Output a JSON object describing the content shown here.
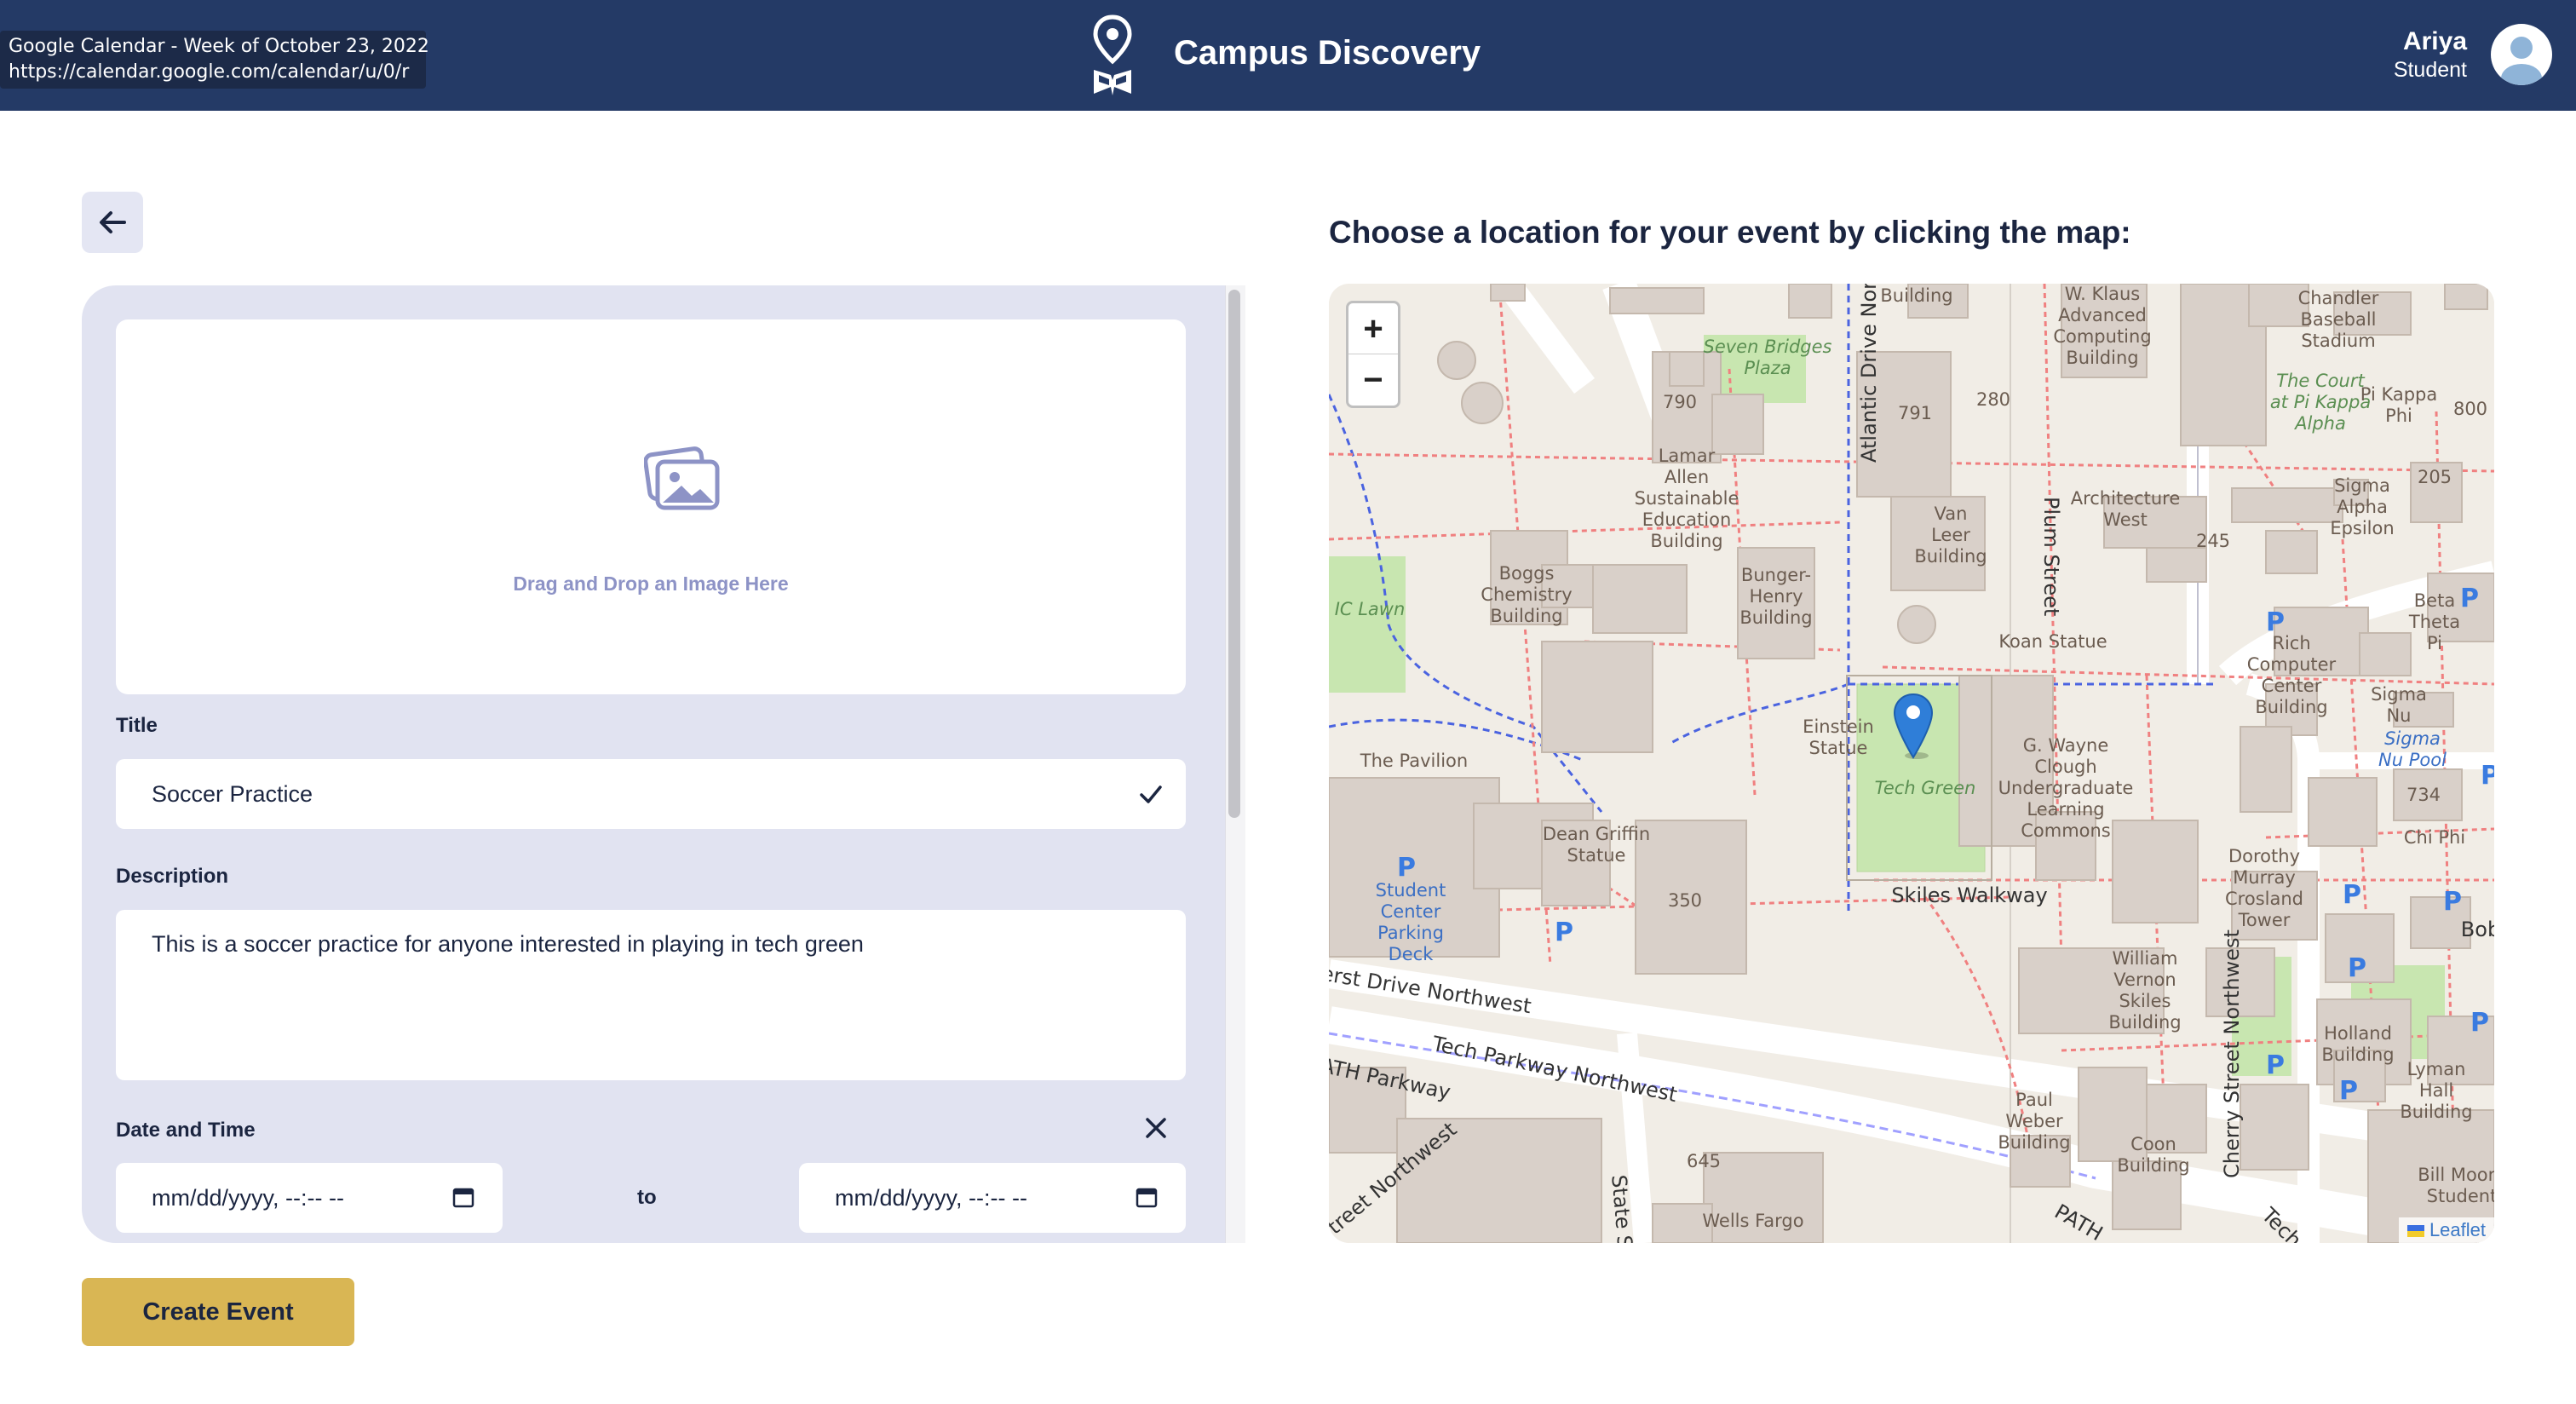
{
  "tooltip": {
    "title": "Google Calendar - Week of October 23, 2022",
    "url": "https://calendar.google.com/calendar/u/0/r"
  },
  "header": {
    "app_title": "Campus Discovery",
    "user_name": "Ariya",
    "user_role": "Student"
  },
  "form": {
    "dropzone_text": "Drag and Drop an Image Here",
    "title_label": "Title",
    "title_value": "Soccer Practice",
    "description_label": "Description",
    "description_value": "This is a soccer practice for anyone interested in playing in tech green",
    "datetime_label": "Date and Time",
    "start_placeholder": "mm/dd/yyyy, --:-- --",
    "separator": "to",
    "end_placeholder": "mm/dd/yyyy, --:-- --",
    "submit_label": "Create Event"
  },
  "map": {
    "heading": "Choose a location for your event by clicking the map:",
    "zoom_in": "+",
    "zoom_out": "−",
    "attribution": "Leaflet",
    "labels": {
      "building": "Building",
      "klaus": "W. Klaus\nAdvanced\nComputing\nBuilding",
      "chandler": "Chandler\nBaseball\nStadium",
      "seven_bridges": "Seven Bridges\nPlaza",
      "n790": "790",
      "n791": "791",
      "n280": "280",
      "court": "The Court\nat Pi Kappa\nAlpha",
      "pikappa": "Pi Kappa\nPhi",
      "n800": "800",
      "lamar": "Lamar\nAllen\nSustainable\nEducation\nBuilding",
      "vanleer": "Van\nLeer\nBuilding",
      "arch_west": "Architecture\nWest",
      "n245": "245",
      "n205": "205",
      "sigma_alpha": "Sigma\nAlpha\nEpsilon",
      "atlantic": "Atlantic Drive Northwest",
      "plum": "Plum Street",
      "boggs": "Boggs\nChemistry\nBuilding",
      "bunger": "Bunger-\nHenry\nBuilding",
      "ic_lawn": "IC Lawn",
      "koan": "Koan Statue",
      "beta": "Beta\nTheta\nPi",
      "rich": "Rich\nComputer\nCenter\nBuilding",
      "einstein": "Einstein\nStatue",
      "tech_green": "Tech Green",
      "clough": "G. Wayne\nClough\nUndergraduate\nLearning\nCommons",
      "sigma_nu": "Sigma\nNu",
      "sigma_nu_pool": "Sigma\nNu Pool",
      "pavilion": "The Pavilion",
      "n734": "734",
      "chi_phi": "Chi Phi",
      "dean_griffin": "Dean Griffin\nStatue",
      "skiles_walkway": "Skiles Walkway",
      "student_center": "Student\nCenter\nParking\nDeck",
      "n350": "350",
      "dorothy": "Dorothy\nMurray\nCrosland\nTower",
      "ferst": "Ferst Drive Northwest",
      "skiles": "William\nVernon\nSkiles\nBuilding",
      "cherry": "Cherry Street Northwest",
      "bob": "Bob",
      "techpkwy": "Tech Parkway Northwest",
      "holland": "Holland\nBuilding",
      "lyman": "Lyman\nHall\nBuilding",
      "path": "PATH Parkway",
      "paul_weber": "Paul\nWeber\nBuilding",
      "coon": "Coon\nBuilding",
      "bill_moore": "Bill Moore\nStudent",
      "street_nw": "e Street Northwest",
      "n645": "645",
      "state": "State St",
      "wells": "Wells Fargo",
      "path2": "PATH",
      "tech2": "Tech"
    },
    "colors": {
      "background": "#f1ede6",
      "building": "#d9d0c9",
      "building_stroke": "#c4b8ad",
      "green": "#c8e6b0",
      "road": "#ffffff",
      "footway": "#f08080",
      "path_blue": "#4a63e0",
      "pin": "#2f7ed8"
    }
  },
  "colors": {
    "header": "#243a66",
    "panel": "#e1e3f1",
    "accent_button": "#d9b654",
    "text_dark": "#1b2540"
  },
  "icons": {
    "logo": "map-pin-book-icon",
    "avatar": "user-avatar-icon",
    "back": "arrow-left-icon",
    "image": "images-icon",
    "check": "check-icon",
    "clear": "close-icon",
    "calendar": "calendar-icon",
    "marker": "map-marker-icon"
  }
}
